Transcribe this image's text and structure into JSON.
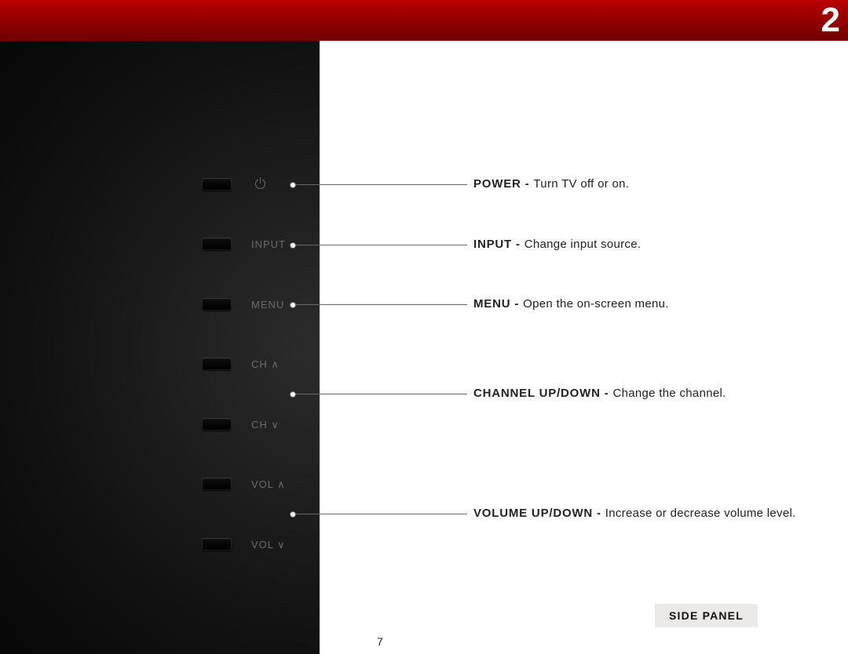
{
  "header": {
    "number": "2"
  },
  "panel": {
    "buttons": [
      {
        "key": "power",
        "label": "",
        "icon": "power-icon"
      },
      {
        "key": "input",
        "label": "INPUT"
      },
      {
        "key": "menu",
        "label": "MENU"
      },
      {
        "key": "ch_up",
        "label": "CH ∧"
      },
      {
        "key": "ch_dn",
        "label": "CH ∨"
      },
      {
        "key": "vol_up",
        "label": "VOL ∧"
      },
      {
        "key": "vol_dn",
        "label": "VOL ∨"
      }
    ]
  },
  "callouts": {
    "power": {
      "bold": "POWER - ",
      "text": "Turn TV off or on."
    },
    "input": {
      "bold": "INPUT - ",
      "text": "Change input source."
    },
    "menu": {
      "bold": "MENU - ",
      "text": "Open the on-screen menu."
    },
    "channel": {
      "bold": "CHANNEL UP/DOWN - ",
      "text": "Change the channel."
    },
    "volume": {
      "bold": "VOLUME UP/DOWN - ",
      "text": "Increase or decrease volume level."
    }
  },
  "footer": {
    "section_label": "SIDE PANEL",
    "page_number": "7"
  }
}
